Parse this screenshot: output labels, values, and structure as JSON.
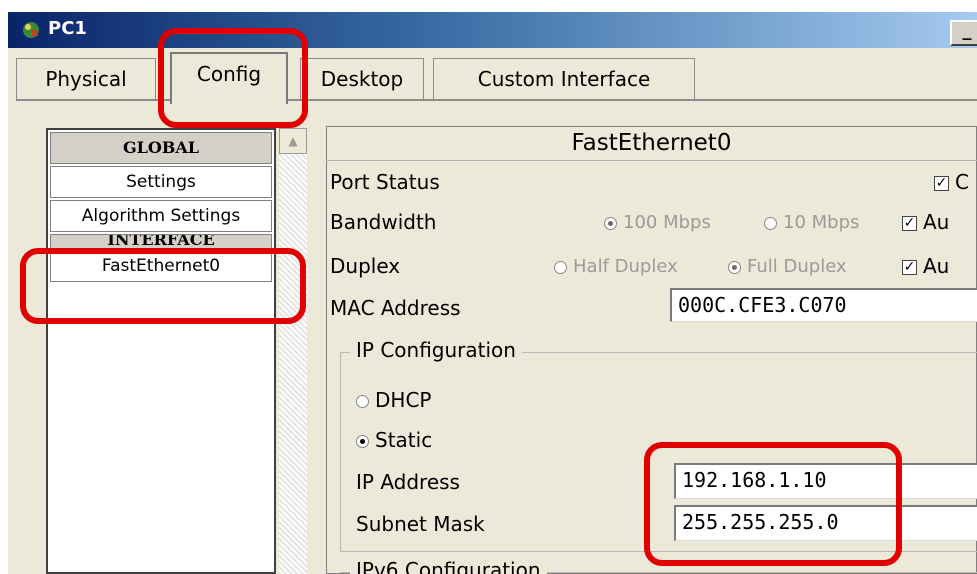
{
  "window": {
    "title": "PC1"
  },
  "tabs": [
    {
      "label": "Physical"
    },
    {
      "label": "Config"
    },
    {
      "label": "Desktop"
    },
    {
      "label": "Custom Interface"
    }
  ],
  "sidebar": {
    "global_header": "GLOBAL",
    "items_global": [
      "Settings",
      "Algorithm Settings"
    ],
    "interface_header": "INTERFACE",
    "items_interface": [
      "FastEthernet0"
    ]
  },
  "panel": {
    "title": "FastEthernet0",
    "port_status": {
      "label": "Port Status",
      "checkbox_text": "C"
    },
    "bandwidth": {
      "label": "Bandwidth",
      "opt1": "100 Mbps",
      "opt2": "10 Mbps",
      "auto": "Au"
    },
    "duplex": {
      "label": "Duplex",
      "opt1": "Half Duplex",
      "opt2": "Full Duplex",
      "auto": "Au"
    },
    "mac": {
      "label": "MAC Address",
      "value": "000C.CFE3.C070"
    },
    "ip_config": {
      "title": "IP Configuration",
      "dhcp": "DHCP",
      "static": "Static",
      "ip_label": "IP Address",
      "ip_value": "192.168.1.10",
      "mask_label": "Subnet Mask",
      "mask_value": "255.255.255.0"
    },
    "ipv6_title": "IPv6 Configuration"
  },
  "colors": {
    "annotation": "#e00000",
    "titlebar_start": "#0a246a",
    "titlebar_end": "#a6caf0"
  }
}
